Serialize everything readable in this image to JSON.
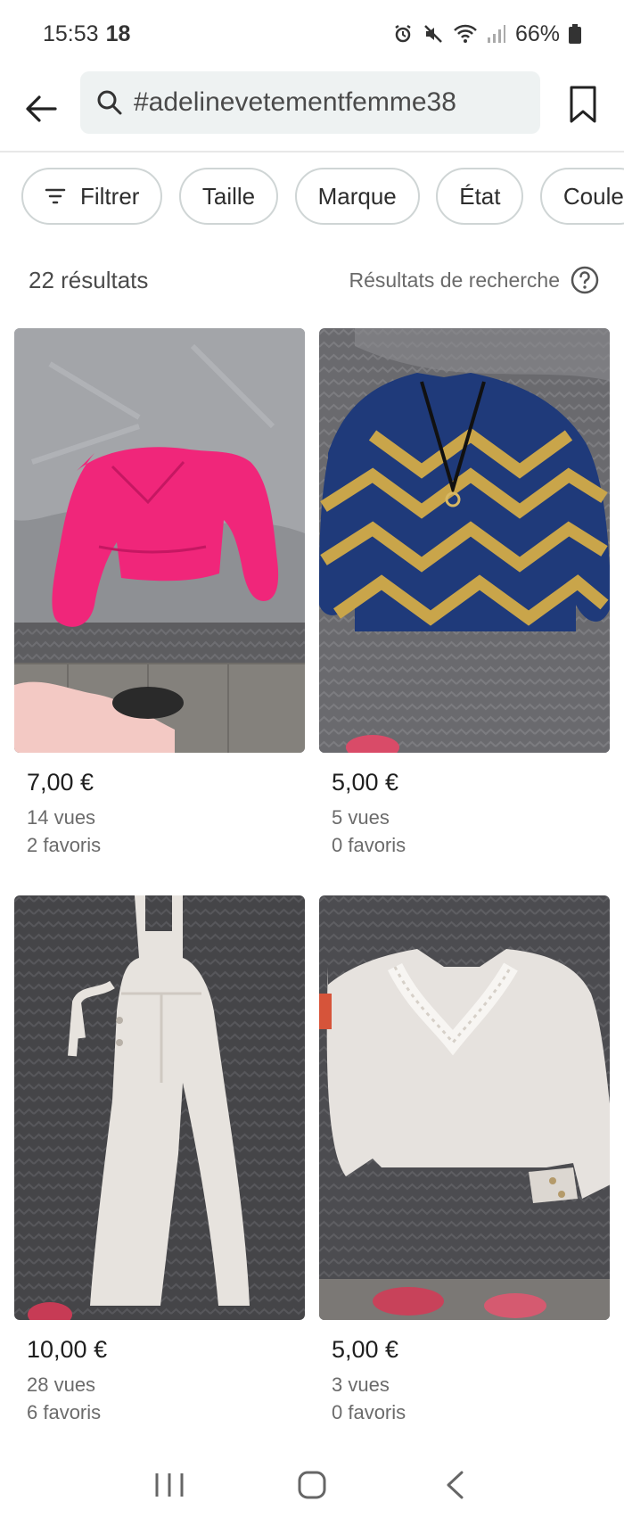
{
  "status_bar": {
    "time": "15:53",
    "temperature": "18",
    "battery": "66%"
  },
  "search": {
    "query": "#adelinevetementfemme38"
  },
  "chips": [
    {
      "label": "Filtrer",
      "icon": "filter-icon"
    },
    {
      "label": "Taille"
    },
    {
      "label": "Marque"
    },
    {
      "label": "État"
    },
    {
      "label": "Coule"
    }
  ],
  "results": {
    "count_label": "22 résultats",
    "info_label": "Résultats de recherche"
  },
  "items": [
    {
      "price": "7,00 €",
      "views": "14 vues",
      "favorites": "2 favoris",
      "photo": "pink blouse on grey bedsheet"
    },
    {
      "price": "5,00 €",
      "views": "5 vues",
      "favorites": "0 favoris",
      "photo": "navy blouse with gold chevrons"
    },
    {
      "price": "10,00 €",
      "views": "28 vues",
      "favorites": "6 favoris",
      "photo": "white dungarees"
    },
    {
      "price": "5,00 €",
      "views": "3 vues",
      "favorites": "0 favoris",
      "photo": "white blouse with lace collar"
    }
  ],
  "colors": {
    "search_bg": "#eef2f2",
    "chip_border": "#cfd5d5",
    "text_primary": "#1f1f1f",
    "text_secondary": "#6b6b6b"
  }
}
